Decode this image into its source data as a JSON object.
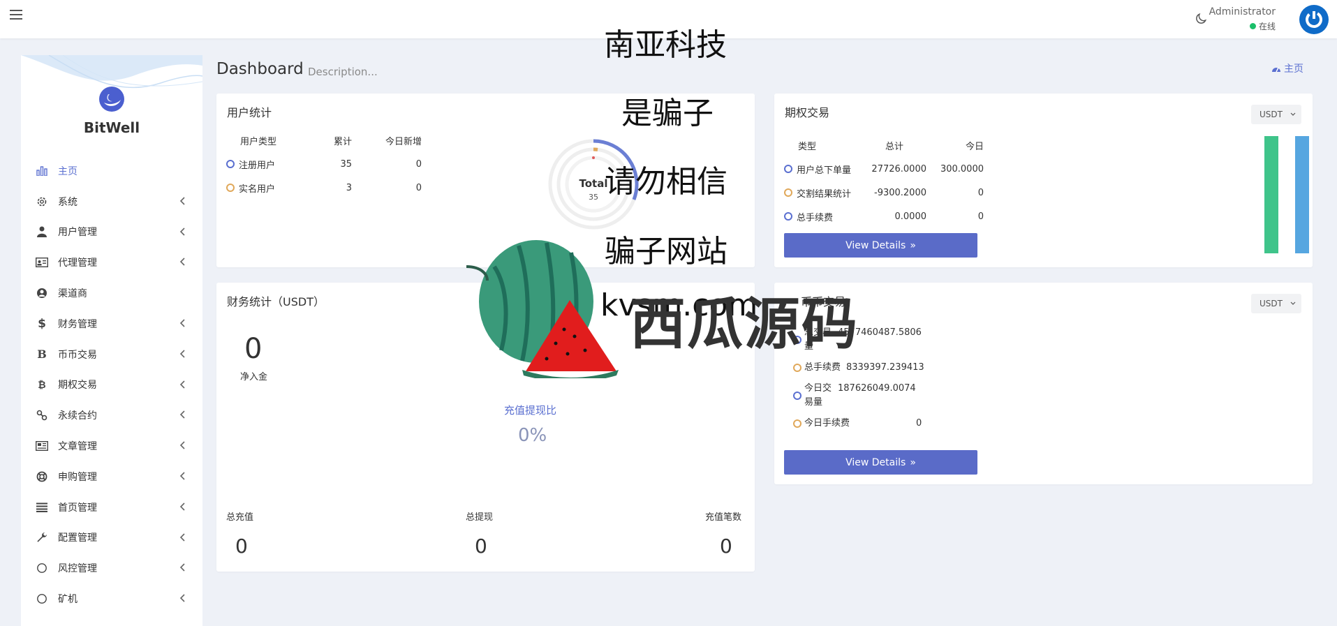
{
  "topbar": {
    "admin_name": "Administrator",
    "status": "在线",
    "status_color": "#1bbf6a"
  },
  "sidebar": {
    "brand": "BitWell",
    "items": [
      {
        "label": "主页",
        "icon": "bar-chart-icon",
        "active": true
      },
      {
        "label": "系统",
        "icon": "gear-icon"
      },
      {
        "label": "用户管理",
        "icon": "user-tie-icon"
      },
      {
        "label": "代理管理",
        "icon": "id-card-icon"
      },
      {
        "label": "渠道商",
        "icon": "user-circle-icon"
      },
      {
        "label": "财务管理",
        "icon": "dollar-icon"
      },
      {
        "label": "币币交易",
        "icon": "bold-b-icon"
      },
      {
        "label": "期权交易",
        "icon": "bitcoin-icon"
      },
      {
        "label": "永续合约",
        "icon": "link-icon"
      },
      {
        "label": "文章管理",
        "icon": "newspaper-icon"
      },
      {
        "label": "申购管理",
        "icon": "life-ring-icon"
      },
      {
        "label": "首页管理",
        "icon": "list-icon"
      },
      {
        "label": "配置管理",
        "icon": "wrench-icon"
      },
      {
        "label": "风控管理",
        "icon": "circle-icon"
      },
      {
        "label": "矿机",
        "icon": "circle-icon"
      }
    ]
  },
  "header": {
    "title": "Dashboard",
    "description": "Description...",
    "breadcrumb_home": "主页"
  },
  "user_stats": {
    "title": "用户统计",
    "columns": [
      "用户类型",
      "累计",
      "今日新增"
    ],
    "rows": [
      {
        "type": "注册用户",
        "total": "35",
        "today": "0"
      },
      {
        "type": "实名用户",
        "total": "3",
        "today": "0"
      }
    ],
    "donut_label": "Total",
    "donut_value": "35"
  },
  "options": {
    "title": "期权交易",
    "currency": "USDT",
    "columns": [
      "类型",
      "总计",
      "今日"
    ],
    "rows": [
      {
        "type": "用户总下单量",
        "total": "27726.0000",
        "today": "300.0000"
      },
      {
        "type": "交割结果统计",
        "total": "-9300.2000",
        "today": "0"
      },
      {
        "type": "总手续费",
        "total": "0.0000",
        "today": "0"
      }
    ],
    "button": "View Details"
  },
  "finance": {
    "title": "财务统计（USDT）",
    "net_value": "0",
    "net_label": "净入金",
    "ratio_label": "充值提现比",
    "ratio_value": "0%",
    "totals": [
      {
        "label": "总充值",
        "value": "0"
      },
      {
        "label": "总提现",
        "value": "0"
      },
      {
        "label": "充值笔数",
        "value": "0"
      }
    ]
  },
  "coin": {
    "title": "币币交易",
    "currency": "USDT",
    "rows": [
      {
        "label": "总交易量",
        "value": "4577460487.5806"
      },
      {
        "label": "总手续费",
        "value": "8339397.239413"
      },
      {
        "label": "今日交易量",
        "value": "187626049.0074"
      },
      {
        "label": "今日手续费",
        "value": "0"
      }
    ],
    "button": "View Details"
  },
  "watermark": {
    "lines": [
      "南亚科技",
      "是骗子",
      "请勿相信",
      "骗子网站"
    ],
    "domain": "kvsm.com",
    "brand": "西瓜源码"
  },
  "colors": {
    "accent": "#5a6fd0",
    "button": "#5a6bc8",
    "bar_green": "#3fc48a",
    "bar_blue": "#56a6e0"
  }
}
